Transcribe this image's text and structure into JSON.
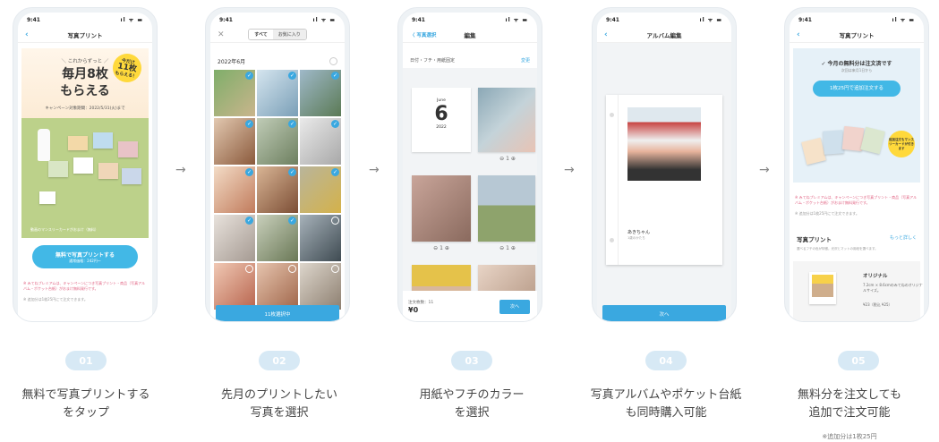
{
  "status": {
    "time": "9:41",
    "signal": "ıl ᯤ ▬"
  },
  "screen1": {
    "title": "写真プリント",
    "promo_sub": "＼ これからずっと ／",
    "promo_big_1": "毎月8枚",
    "promo_big_2": "もらえる",
    "promo_period": "キャンペーン対象期間：2022/5/31(火)まで",
    "badge_line1": "今だけ",
    "badge_num": "11枚",
    "badge_line2": "もらえる！",
    "promo_foot": "動画のマンスリーカードがおまけ（無料）",
    "cta_label": "無料で写真プリントする",
    "cta_sub": "通常価格：242円〜",
    "fine_pink": "※ みてねプレミアムは、キャンペーンにつき写真プリント・商品（写真アルバム・ポケット台紙）がおまけ無料発行です。",
    "fine_grey": "※ 追加分は1枚25円にて注文できます。"
  },
  "screen2": {
    "tab_all": "すべて",
    "tab_fav": "お気に入り",
    "month": "2022年6月",
    "bottom_button": "11枚選択中"
  },
  "screen3": {
    "back_label": "〈 写真選択",
    "title": "編集",
    "subbar_left": "日付・フチ・用紙固定",
    "subbar_right": "変更",
    "date_month": "June",
    "date_day": "6",
    "date_year": "2022",
    "stepper_1": "⊖  1  ⊕",
    "stepper_2": "⊖  1  ⊕",
    "stepper_3": "⊖  1  ⊕",
    "order_label": "注文枚数：11",
    "order_price": "¥0",
    "next_button": "次へ"
  },
  "screen4": {
    "title": "アルバム編集",
    "album_name": "あきちゃん",
    "album_sub": "1歳のかたち",
    "next_button": "次へ"
  },
  "screen5": {
    "title": "写真プリント",
    "info_title": "✓ 今月の無料分は注文済です",
    "info_sub": "次回は来月1日から",
    "add_button": "1枚25円で追加注文する",
    "badge": "追加注文もマンスリーカードが付きます",
    "fine_pink": "※ みてねプレミアムは、キャンペーンにつき写真プリント・商品（写真アルバム・ポケット台紙）がおまけ無料発行です。",
    "fine_grey": "※ 追加分は1枚25円にて注文できます。",
    "section_title": "写真プリント",
    "section_more": "もっと詳しく",
    "section_sub": "選べるフチの色が特徴。光沢とマットの用紙を選べます。",
    "product_title": "オリジナル",
    "product_desc": "7.2cm × 8.6cmのみてねのオリジナルサイズ。",
    "product_price": "¥23（税込 ¥25）"
  },
  "arrows": [
    "→",
    "→",
    "→",
    "→"
  ],
  "steps": [
    {
      "num": "01",
      "line1": "無料で写真プリントする",
      "line2": "をタップ"
    },
    {
      "num": "02",
      "line1": "先月のプリントしたい",
      "line2": "写真を選択"
    },
    {
      "num": "03",
      "line1": "用紙やフチのカラー",
      "line2": "を選択"
    },
    {
      "num": "04",
      "line1": "写真アルバムやポケット台紙",
      "line2": "も同時購入可能"
    },
    {
      "num": "05",
      "line1": "無料分を注文しても",
      "line2": "追加で注文可能"
    }
  ],
  "step5_note": "※追加分は1枚25円",
  "colors": {
    "accent": "#3aa8e0",
    "cta": "#42b8e6",
    "badge_bg": "#d7e9f5",
    "yellow": "#ffd93b",
    "pink_note": "#e06080"
  }
}
